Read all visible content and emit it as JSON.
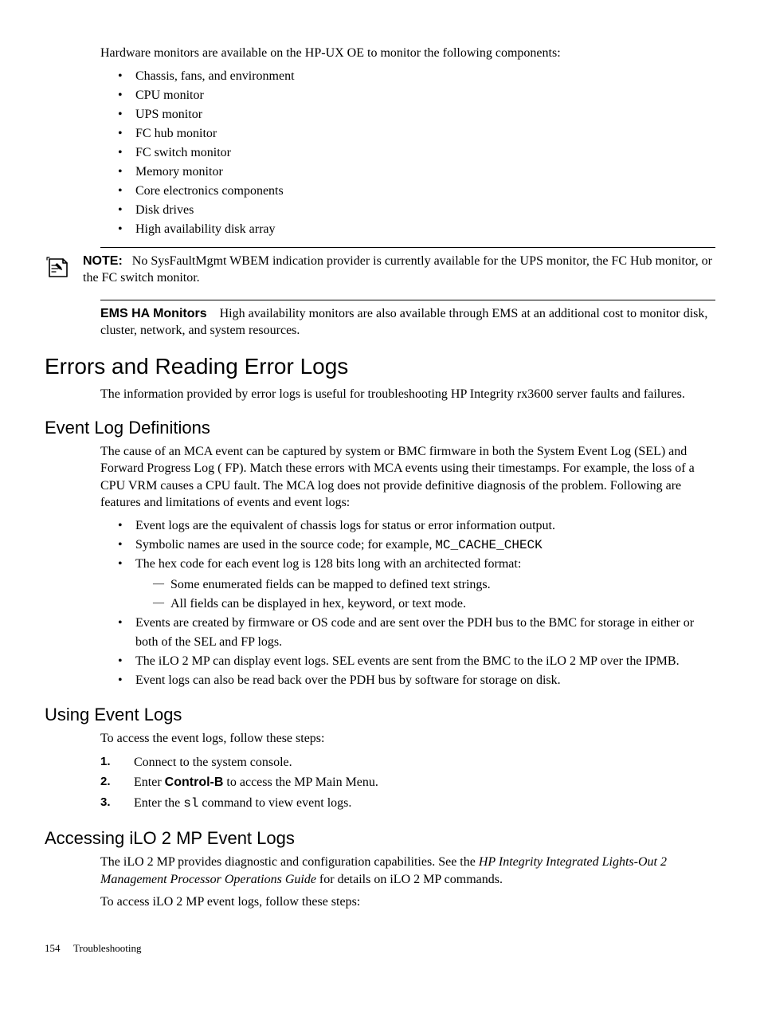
{
  "intro": "Hardware monitors are available on the HP-UX OE to monitor the following components:",
  "hw_list": [
    "Chassis, fans, and environment",
    "CPU monitor",
    "UPS monitor",
    "FC hub monitor",
    "FC switch monitor",
    "Memory monitor",
    "Core electronics components",
    "Disk drives",
    "High availability disk array"
  ],
  "note": {
    "prefix": "NOTE:",
    "text": "No SysFaultMgmt WBEM indication provider is currently available for the UPS monitor, the FC Hub monitor, or the FC switch monitor."
  },
  "ems": {
    "runin": "EMS HA Monitors",
    "text": "High availability monitors are also available through EMS at an additional cost to monitor disk, cluster, network, and system resources."
  },
  "h1": "Errors and Reading Error Logs",
  "h1_para": "The information provided by error logs is useful for troubleshooting HP Integrity rx3600 server faults and failures.",
  "h2_defs": "Event Log Definitions",
  "defs_para": "The cause of an MCA event can be captured by system or BMC firmware in both the System Event Log (SEL) and Forward Progress Log ( FP). Match these errors with MCA events using their timestamps. For example, the loss of a CPU VRM causes a CPU fault. The MCA log does not provide definitive diagnosis of the problem. Following are features and limitations of events and event logs:",
  "defs_b1": "Event logs are the equivalent of chassis logs for status or error information output.",
  "defs_b2_a": "Symbolic names are used in the source code; for example, ",
  "defs_b2_code": "MC_CACHE_CHECK",
  "defs_b3": "The hex code for each event log is 128 bits long with an architected format:",
  "defs_b3_sub": [
    "Some enumerated fields can be mapped to defined text strings.",
    "All fields can be displayed in hex, keyword, or text mode."
  ],
  "defs_b4": "Events are created by firmware or OS code and are sent over the PDH bus to the BMC for storage in either or both of the SEL and FP logs.",
  "defs_b5": "The iLO 2 MP can display event logs. SEL events are sent from the BMC to the iLO 2 MP over the IPMB.",
  "defs_b6": "Event logs can also be read back over the PDH bus by software for storage on disk.",
  "h2_using": "Using Event Logs",
  "using_para": "To access the event logs, follow these steps:",
  "using_step1": "Connect to the system console.",
  "using_step2_a": "Enter ",
  "using_step2_bold": "Control-B",
  "using_step2_b": " to access the MP Main Menu.",
  "using_step3_a": "Enter the ",
  "using_step3_code": "sl",
  "using_step3_b": " command to view event logs.",
  "h2_ilo": "Accessing iLO 2 MP Event Logs",
  "ilo_p1_a": "The iLO 2 MP provides diagnostic and configuration capabilities. See the ",
  "ilo_p1_italic": "HP Integrity Integrated Lights-Out 2 Management Processor Operations Guide",
  "ilo_p1_b": " for details on iLO 2 MP commands.",
  "ilo_p2": "To access iLO 2 MP event logs, follow these steps:",
  "footer_page": "154",
  "footer_text": "Troubleshooting"
}
